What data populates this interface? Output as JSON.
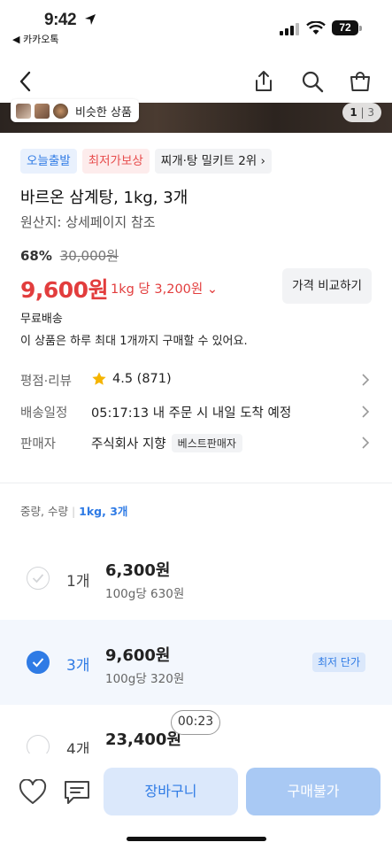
{
  "status": {
    "time": "9:42",
    "back_app": "◀ 카카오톡",
    "battery": "72"
  },
  "gallery": {
    "similar_label": "비슷한 상품",
    "counter_current": "1",
    "counter_total": "3"
  },
  "tags": [
    {
      "label": "오늘출발",
      "style": "blue"
    },
    {
      "label": "최저가보상",
      "style": "red"
    },
    {
      "label": "찌개·탕 밀키트 2위 ›",
      "style": "gray"
    }
  ],
  "product": {
    "title": "바르온 삼계탕, 1kg, 3개",
    "origin": "원산지: 상세페이지 참조",
    "discount_rate": "68%",
    "original_price": "30,000원",
    "price": "9,600원",
    "unit_price": "1kg 당 3,200원 ⌄",
    "compare_label": "가격 비교하기",
    "shipping": "무료배송",
    "limit_note": "이 상품은 하루 최대 1개까지 구매할 수 있어요."
  },
  "info": {
    "rating_label": "평점·리뷰",
    "rating_value": "4.5 (871)",
    "delivery_label": "배송일정",
    "delivery_value": "05:17:13 내 주문 시 내일 도착 예정",
    "seller_label": "판매자",
    "seller_value": "주식회사 지향",
    "seller_badge": "베스트판매자"
  },
  "options": {
    "label": "중량, 수량",
    "selected_value": "1kg, 3개",
    "items": [
      {
        "qty": "1개",
        "price": "6,300원",
        "unit": "100g당 630원",
        "selected": false
      },
      {
        "qty": "3개",
        "price": "9,600원",
        "unit": "100g당 320원",
        "selected": true,
        "badge": "최저 단가"
      },
      {
        "qty": "4개",
        "price": "23,400원",
        "unit": "",
        "selected": false
      }
    ]
  },
  "timer": "00:23",
  "actions": {
    "cart_label": "장바구니",
    "buy_label": "구매불가"
  },
  "colors": {
    "accent": "#2f7be5",
    "price_red": "#e23d3d",
    "star": "#f5b400"
  }
}
